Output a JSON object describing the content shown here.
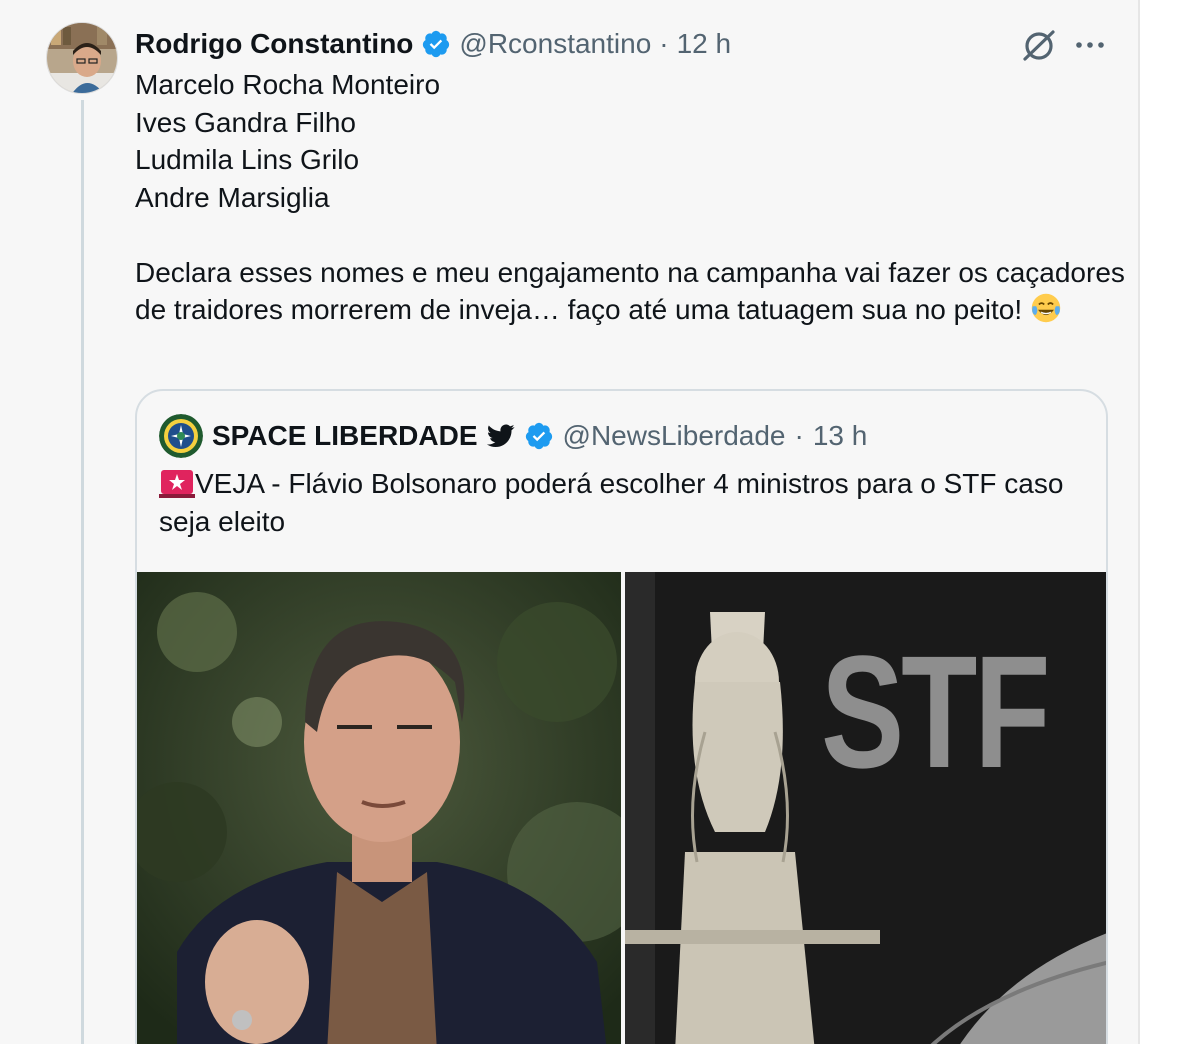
{
  "tweet": {
    "author_name": "Rodrigo Constantino",
    "author_handle": "@Rconstantino",
    "separator": "·",
    "time": "12 h",
    "lines": [
      "Marcelo Rocha Monteiro",
      "Ives Gandra Filho",
      "Ludmila Lins Grilo",
      "Andre Marsiglia"
    ],
    "paragraph": "Declara esses nomes e meu engajamento na campanha vai fazer os caçadores de traidores morrerem de inveja… faço até uma tatuagem sua no peito!",
    "emoji": "face-with-tears-of-joy-icon"
  },
  "quote": {
    "author_name": "SPACE LIBERDADE",
    "author_handle": "@NewsLiberdade",
    "separator": "·",
    "time": "13 h",
    "text": "VEJA - Flávio Bolsonaro poderá escolher 4 ministros para o STF caso seja eleito",
    "media_right_sign": "STF"
  },
  "colors": {
    "verified": "#1d9bf0",
    "secondary_text": "#536471",
    "background": "#f7f7f7",
    "siren": "#e0245e"
  }
}
